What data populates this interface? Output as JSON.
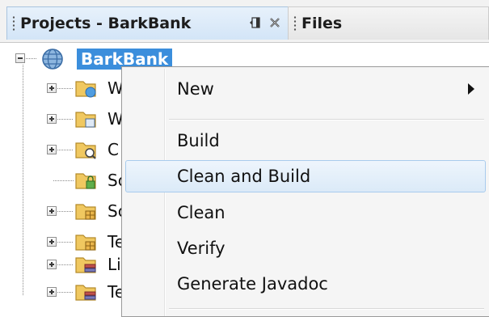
{
  "tabs": [
    {
      "label": "Projects - BarkBank",
      "active": true
    },
    {
      "label": "Files",
      "active": false
    }
  ],
  "tab_controls": {
    "minimize_icon": "minimize-window-icon",
    "close_icon": "close-x-icon"
  },
  "tree": {
    "root": {
      "label": "BarkBank",
      "icon": "globe-icon",
      "expanded": true
    },
    "children": [
      {
        "label": "W",
        "icon": "web-pages-folder-icon",
        "expandable": true
      },
      {
        "label": "W",
        "icon": "web-inf-folder-icon",
        "expandable": true
      },
      {
        "label": "C",
        "icon": "config-files-folder-icon",
        "expandable": true
      },
      {
        "label": "Sc",
        "icon": "server-resources-folder-icon",
        "expandable": false
      },
      {
        "label": "Sc",
        "icon": "source-packages-folder-icon",
        "expandable": true
      },
      {
        "label": "Te",
        "icon": "test-packages-folder-icon",
        "expandable": true
      },
      {
        "label": "Li",
        "icon": "libraries-folder-icon",
        "expandable": true
      },
      {
        "label": "Te",
        "icon": "test-libraries-folder-icon",
        "expandable": true
      }
    ]
  },
  "context_menu": {
    "items": [
      {
        "label": "New",
        "has_submenu": true
      },
      {
        "label": "Build"
      },
      {
        "label": "Clean and Build",
        "highlighted": true
      },
      {
        "label": "Clean"
      },
      {
        "label": "Verify"
      },
      {
        "label": "Generate Javadoc"
      }
    ]
  },
  "colors": {
    "selection": "#3b8edc",
    "menu_highlight": "#dbeaf8",
    "folder": "#f0c860"
  }
}
